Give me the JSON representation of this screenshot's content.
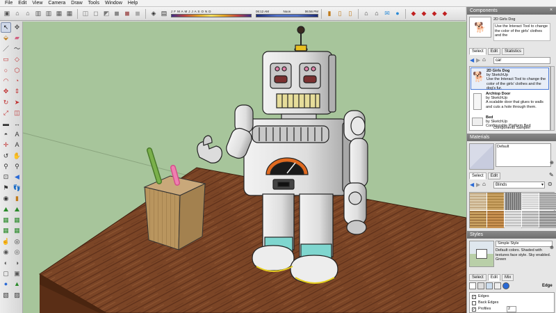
{
  "menu": [
    "File",
    "Edit",
    "View",
    "Camera",
    "Draw",
    "Tools",
    "Window",
    "Help"
  ],
  "shadow": {
    "months": "J F M A M J J A S O N D",
    "time_start": "06:12 AM",
    "time_noon": "Noon",
    "time_end": "06:56 PM"
  },
  "components": {
    "title": "Components",
    "preview_name": "2D Girls Dog",
    "preview_desc": "Use the Interact Tool to change the color of the girls' clothes and the",
    "tabs": [
      "Select",
      "Edit",
      "Statistics"
    ],
    "search_value": "car",
    "items": [
      {
        "name": "2D Girls Dog",
        "by": "by SketchUp",
        "desc": "Use the Interact Tool to change the color of the girls' clothes and the dog's fur."
      },
      {
        "name": "Archtop Door",
        "by": "by SketchUp",
        "desc": "A scalable door that glues to walls and cuts a hole through them."
      },
      {
        "name": "Bed",
        "by": "by SketchUp",
        "desc": "Configurable Platform Bed"
      }
    ],
    "footer": "Components Sampler"
  },
  "materials": {
    "title": "Materials",
    "current": "Default",
    "tabs": [
      "Select",
      "Edit"
    ],
    "library": "Blinds"
  },
  "styles": {
    "title": "Styles",
    "name": "Simple Style",
    "desc": "Default colors. Shaded with textures face style. Sky enabled. Green",
    "tabs": [
      "Select",
      "Edit",
      "Mix"
    ],
    "section": "Edge",
    "options": [
      {
        "label": "Edges",
        "checked": true
      },
      {
        "label": "Back Edges",
        "checked": false
      },
      {
        "label": "Profiles",
        "checked": true,
        "value": "2"
      }
    ]
  }
}
